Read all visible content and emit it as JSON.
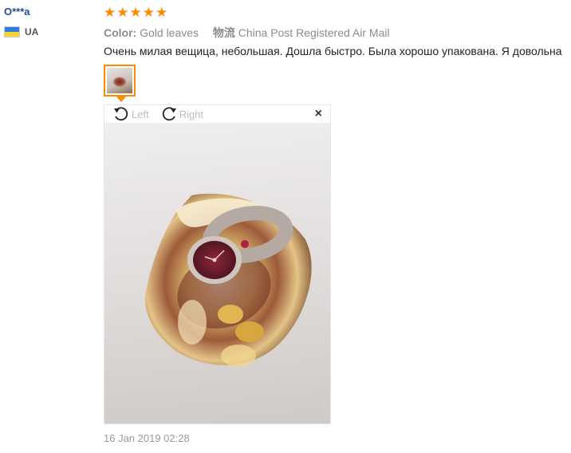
{
  "reviewer": {
    "name": "O***a",
    "country_code": "UA",
    "flag_colors": [
      "#2f7fd8",
      "#f8d23a"
    ]
  },
  "rating": {
    "stars": 5,
    "star_color": "#ff8a00"
  },
  "attributes": {
    "color_key": "Color:",
    "color_value": "Gold leaves",
    "shipping_key": "物流",
    "shipping_value": "China Post Registered Air Mail"
  },
  "review": {
    "text": "Очень милая вещица, небольшая. Дошла быстро. Была хорошо упакована. Я довольна",
    "date": "16 Jan 2019 02:28"
  },
  "viewer": {
    "rotate_left_label": "Left",
    "rotate_right_label": "Right",
    "close_symbol": "×"
  }
}
